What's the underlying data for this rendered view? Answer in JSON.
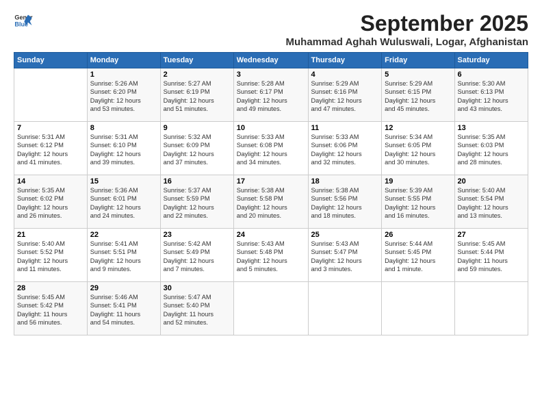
{
  "logo": {
    "line1": "General",
    "line2": "Blue"
  },
  "title": "September 2025",
  "subtitle": "Muhammad Aghah Wuluswali, Logar, Afghanistan",
  "header": {
    "days": [
      "Sunday",
      "Monday",
      "Tuesday",
      "Wednesday",
      "Thursday",
      "Friday",
      "Saturday"
    ]
  },
  "weeks": [
    [
      {
        "day": "",
        "info": ""
      },
      {
        "day": "1",
        "info": "Sunrise: 5:26 AM\nSunset: 6:20 PM\nDaylight: 12 hours\nand 53 minutes."
      },
      {
        "day": "2",
        "info": "Sunrise: 5:27 AM\nSunset: 6:19 PM\nDaylight: 12 hours\nand 51 minutes."
      },
      {
        "day": "3",
        "info": "Sunrise: 5:28 AM\nSunset: 6:17 PM\nDaylight: 12 hours\nand 49 minutes."
      },
      {
        "day": "4",
        "info": "Sunrise: 5:29 AM\nSunset: 6:16 PM\nDaylight: 12 hours\nand 47 minutes."
      },
      {
        "day": "5",
        "info": "Sunrise: 5:29 AM\nSunset: 6:15 PM\nDaylight: 12 hours\nand 45 minutes."
      },
      {
        "day": "6",
        "info": "Sunrise: 5:30 AM\nSunset: 6:13 PM\nDaylight: 12 hours\nand 43 minutes."
      }
    ],
    [
      {
        "day": "7",
        "info": "Sunrise: 5:31 AM\nSunset: 6:12 PM\nDaylight: 12 hours\nand 41 minutes."
      },
      {
        "day": "8",
        "info": "Sunrise: 5:31 AM\nSunset: 6:10 PM\nDaylight: 12 hours\nand 39 minutes."
      },
      {
        "day": "9",
        "info": "Sunrise: 5:32 AM\nSunset: 6:09 PM\nDaylight: 12 hours\nand 37 minutes."
      },
      {
        "day": "10",
        "info": "Sunrise: 5:33 AM\nSunset: 6:08 PM\nDaylight: 12 hours\nand 34 minutes."
      },
      {
        "day": "11",
        "info": "Sunrise: 5:33 AM\nSunset: 6:06 PM\nDaylight: 12 hours\nand 32 minutes."
      },
      {
        "day": "12",
        "info": "Sunrise: 5:34 AM\nSunset: 6:05 PM\nDaylight: 12 hours\nand 30 minutes."
      },
      {
        "day": "13",
        "info": "Sunrise: 5:35 AM\nSunset: 6:03 PM\nDaylight: 12 hours\nand 28 minutes."
      }
    ],
    [
      {
        "day": "14",
        "info": "Sunrise: 5:35 AM\nSunset: 6:02 PM\nDaylight: 12 hours\nand 26 minutes."
      },
      {
        "day": "15",
        "info": "Sunrise: 5:36 AM\nSunset: 6:01 PM\nDaylight: 12 hours\nand 24 minutes."
      },
      {
        "day": "16",
        "info": "Sunrise: 5:37 AM\nSunset: 5:59 PM\nDaylight: 12 hours\nand 22 minutes."
      },
      {
        "day": "17",
        "info": "Sunrise: 5:38 AM\nSunset: 5:58 PM\nDaylight: 12 hours\nand 20 minutes."
      },
      {
        "day": "18",
        "info": "Sunrise: 5:38 AM\nSunset: 5:56 PM\nDaylight: 12 hours\nand 18 minutes."
      },
      {
        "day": "19",
        "info": "Sunrise: 5:39 AM\nSunset: 5:55 PM\nDaylight: 12 hours\nand 16 minutes."
      },
      {
        "day": "20",
        "info": "Sunrise: 5:40 AM\nSunset: 5:54 PM\nDaylight: 12 hours\nand 13 minutes."
      }
    ],
    [
      {
        "day": "21",
        "info": "Sunrise: 5:40 AM\nSunset: 5:52 PM\nDaylight: 12 hours\nand 11 minutes."
      },
      {
        "day": "22",
        "info": "Sunrise: 5:41 AM\nSunset: 5:51 PM\nDaylight: 12 hours\nand 9 minutes."
      },
      {
        "day": "23",
        "info": "Sunrise: 5:42 AM\nSunset: 5:49 PM\nDaylight: 12 hours\nand 7 minutes."
      },
      {
        "day": "24",
        "info": "Sunrise: 5:43 AM\nSunset: 5:48 PM\nDaylight: 12 hours\nand 5 minutes."
      },
      {
        "day": "25",
        "info": "Sunrise: 5:43 AM\nSunset: 5:47 PM\nDaylight: 12 hours\nand 3 minutes."
      },
      {
        "day": "26",
        "info": "Sunrise: 5:44 AM\nSunset: 5:45 PM\nDaylight: 12 hours\nand 1 minute."
      },
      {
        "day": "27",
        "info": "Sunrise: 5:45 AM\nSunset: 5:44 PM\nDaylight: 11 hours\nand 59 minutes."
      }
    ],
    [
      {
        "day": "28",
        "info": "Sunrise: 5:45 AM\nSunset: 5:42 PM\nDaylight: 11 hours\nand 56 minutes."
      },
      {
        "day": "29",
        "info": "Sunrise: 5:46 AM\nSunset: 5:41 PM\nDaylight: 11 hours\nand 54 minutes."
      },
      {
        "day": "30",
        "info": "Sunrise: 5:47 AM\nSunset: 5:40 PM\nDaylight: 11 hours\nand 52 minutes."
      },
      {
        "day": "",
        "info": ""
      },
      {
        "day": "",
        "info": ""
      },
      {
        "day": "",
        "info": ""
      },
      {
        "day": "",
        "info": ""
      }
    ]
  ]
}
